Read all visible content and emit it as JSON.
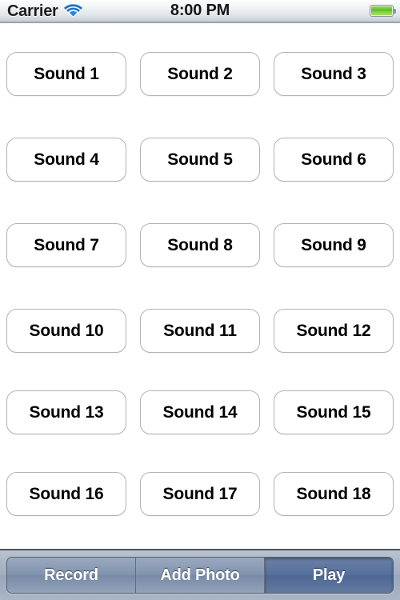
{
  "status_bar": {
    "carrier": "Carrier",
    "wifi_icon": "wifi-icon",
    "time": "8:00 PM",
    "battery_icon": "battery-icon",
    "battery_level_color": "#5cba22"
  },
  "sound_grid": {
    "rows": [
      [
        "Sound 1",
        "Sound 2",
        "Sound 3"
      ],
      [
        "Sound 4",
        "Sound 5",
        "Sound 6"
      ],
      [
        "Sound 7",
        "Sound 8",
        "Sound 9"
      ],
      [
        "Sound 10",
        "Sound 11",
        "Sound 12"
      ],
      [
        "Sound 13",
        "Sound 14",
        "Sound 15"
      ],
      [
        "Sound 16",
        "Sound 17",
        "Sound 18"
      ]
    ]
  },
  "toolbar": {
    "segments": [
      {
        "label": "Record",
        "selected": false
      },
      {
        "label": "Add Photo",
        "selected": false
      },
      {
        "label": "Play",
        "selected": true
      }
    ],
    "selected_color": "#4d6894"
  }
}
